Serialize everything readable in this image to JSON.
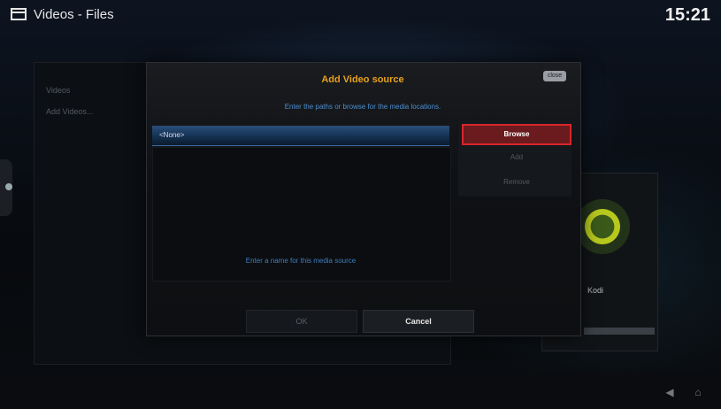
{
  "window": {
    "breadcrumb": "Videos - Files",
    "clock": "15:21"
  },
  "background": {
    "list_items": [
      "Videos",
      "Add Videos..."
    ],
    "thumb_caption": "Kodi"
  },
  "dialog": {
    "title": "Add Video source",
    "close_label": "close",
    "subtitle": "Enter the paths or browse for the media locations.",
    "path_value": "<None>",
    "buttons": {
      "browse": "Browse",
      "add": "Add",
      "remove": "Remove"
    },
    "hint": "Enter a name for this media source",
    "ok": "OK",
    "cancel": "Cancel"
  },
  "colors": {
    "accent_title": "#e7a11c",
    "focus_border": "#d8262b",
    "link_blue": "#4d8fd0"
  }
}
